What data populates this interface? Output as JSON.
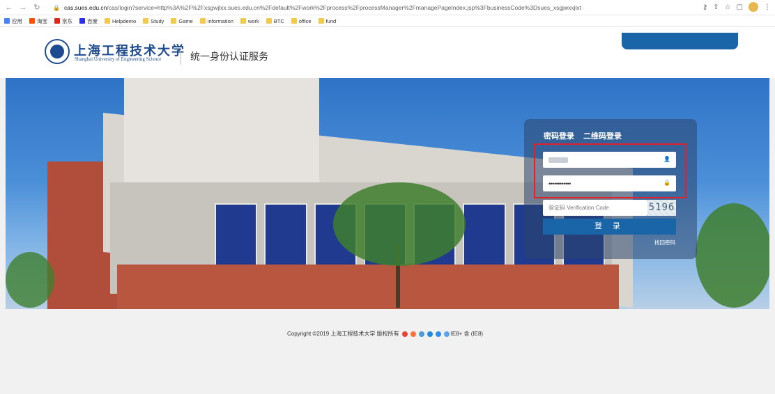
{
  "browser": {
    "url_host": "cas.sues.edu.cn",
    "url_path": "/cas/login?service=http%3A%2F%2Fxsgwjlxx.sues.edu.cn%2Fdefault%2Fwork%2Fprocess%2FprocessManager%2FmanagePageIndex.jsp%3FbusinessCode%3Dsues_xsgjwxxjlxt",
    "bookmarks": [
      "应用",
      "淘宝",
      "京东",
      "百度",
      "Helpdemo",
      "Study",
      "Game",
      "information",
      "work",
      "BTC",
      "office",
      "fund"
    ]
  },
  "header": {
    "school_name_cn": "上海工程技术大学",
    "school_name_en": "Shanghai University of Engineering Science",
    "service_title": "统一身份认证服务"
  },
  "login": {
    "tab_password": "密码登录",
    "tab_qrcode": "二维码登录",
    "password_mask": "••••••••••••",
    "captcha_placeholder": "验证码 Verification Code",
    "captcha_value": "5196",
    "submit_label": "登 录",
    "forgot_label": "找回密码"
  },
  "footer": {
    "copyright": "Copyright ©2019 上海工程技术大学 版权所有",
    "browser_note": "IE8+ 含 (IE8)"
  },
  "colors": {
    "brand_blue": "#1a64a8",
    "highlight_red": "#e2202a",
    "logo_blue": "#1e4b8f"
  }
}
